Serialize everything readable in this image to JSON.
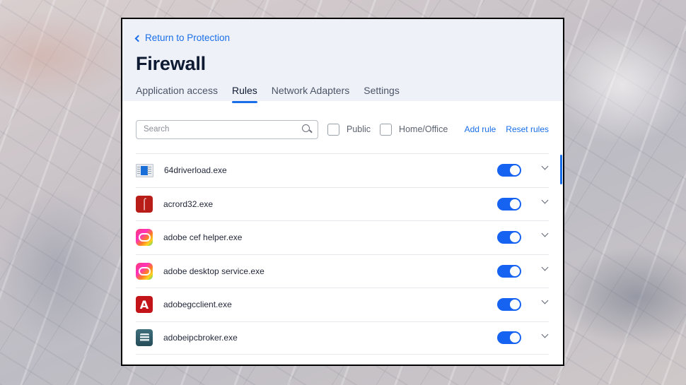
{
  "header": {
    "back_label": "Return to Protection",
    "title": "Firewall",
    "tabs": [
      {
        "label": "Application access",
        "active": false
      },
      {
        "label": "Rules",
        "active": true
      },
      {
        "label": "Network Adapters",
        "active": false
      },
      {
        "label": "Settings",
        "active": false
      }
    ]
  },
  "toolbar": {
    "search_placeholder": "Search",
    "search_value": "",
    "filters": [
      {
        "label": "Public",
        "checked": false
      },
      {
        "label": "Home/Office",
        "checked": false
      }
    ],
    "add_rule_label": "Add rule",
    "reset_rules_label": "Reset rules"
  },
  "rules": [
    {
      "name": "64driverload.exe",
      "icon": "driver-app-icon",
      "enabled": true
    },
    {
      "name": "acrord32.exe",
      "icon": "acrobat-reader-icon",
      "enabled": true
    },
    {
      "name": "adobe cef helper.exe",
      "icon": "creative-cloud-icon",
      "enabled": true
    },
    {
      "name": "adobe desktop service.exe",
      "icon": "creative-cloud-icon",
      "enabled": true
    },
    {
      "name": "adobegcclient.exe",
      "icon": "adobe-logo-icon",
      "enabled": true
    },
    {
      "name": "adobeipcbroker.exe",
      "icon": "ipc-broker-icon",
      "enabled": true
    }
  ],
  "colors": {
    "accent": "#1a6fe8",
    "toggle_on": "#1563f0",
    "header_bg": "#eef1f8",
    "title": "#0f1b33"
  }
}
